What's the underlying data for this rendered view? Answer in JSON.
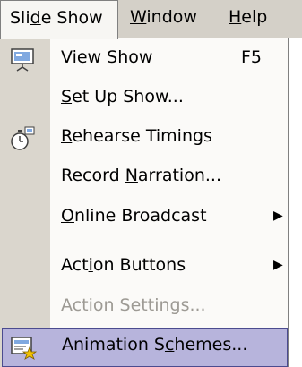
{
  "menubar": {
    "items": [
      {
        "pre": "Sli",
        "key": "d",
        "post": "e Show"
      },
      {
        "pre": "",
        "key": "W",
        "post": "indow"
      },
      {
        "pre": "",
        "key": "H",
        "post": "elp"
      }
    ]
  },
  "dropdown": {
    "items": [
      {
        "pre": "",
        "key": "V",
        "post": "iew Show",
        "shortcut": "F5",
        "icon": "projector-screen-icon"
      },
      {
        "pre": "",
        "key": "S",
        "post": "et Up Show..."
      },
      {
        "pre": "",
        "key": "R",
        "post": "ehearse Timings",
        "icon": "stopwatch-icon"
      },
      {
        "pre": "Record ",
        "key": "N",
        "post": "arration..."
      },
      {
        "pre": "",
        "key": "O",
        "post": "nline Broadcast",
        "submenu": "▶"
      },
      {
        "pre": "Act",
        "key": "i",
        "post": "on Buttons",
        "submenu": "▶"
      },
      {
        "pre": "",
        "key": "A",
        "post": "ction Settings...",
        "disabled": true
      },
      {
        "pre": "Animation S",
        "key": "c",
        "post": "hemes...",
        "highlighted": true,
        "icon": "animation-schemes-icon"
      }
    ]
  },
  "colors": {
    "menubar_bg": "#d4d0c8",
    "gutter_bg": "#dad6cd",
    "highlight_bg": "#b7b4dc",
    "highlight_border": "#4b4b8f",
    "disabled_text": "#9d9a94"
  }
}
